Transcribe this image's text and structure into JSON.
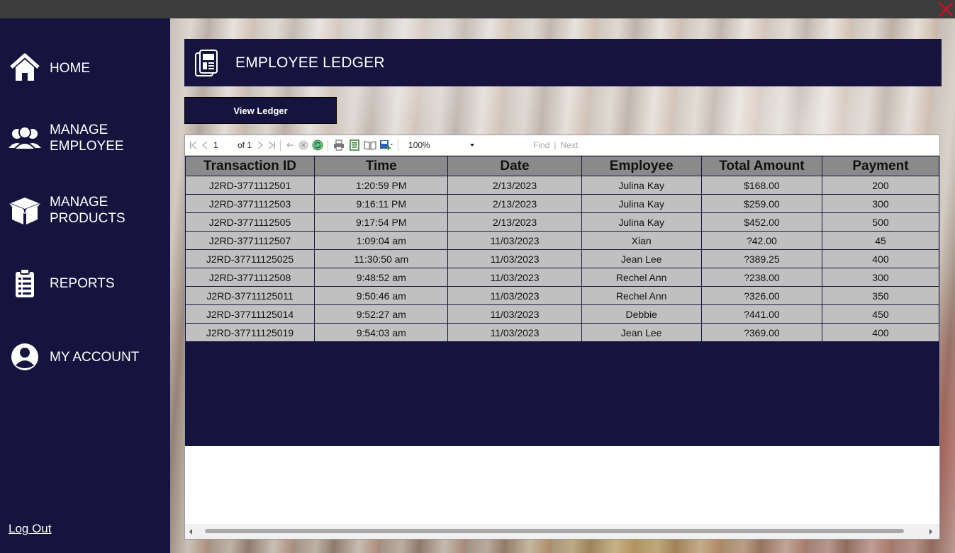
{
  "window": {
    "close_icon": "close-x-icon",
    "close_color": "#d01020"
  },
  "sidebar": {
    "background": "#16143f",
    "items": [
      {
        "label": "HOME",
        "icon": "home-icon"
      },
      {
        "label": "MANAGE\nEMPLOYEE",
        "icon": "users-icon"
      },
      {
        "label": "MANAGE\nPRODUCTS",
        "icon": "box-icon"
      },
      {
        "label": "REPORTS",
        "icon": "clipboard-icon"
      },
      {
        "label": "MY ACCOUNT",
        "icon": "user-circle-icon"
      }
    ],
    "logout_label": "Log Out"
  },
  "header": {
    "title": "EMPLOYEE LEDGER",
    "icon": "ledger-icon"
  },
  "actions": {
    "view_ledger_label": "View Ledger"
  },
  "report_toolbar": {
    "page_current": "1",
    "page_of": "of 1",
    "zoom": "100%",
    "find_label": "Find",
    "next_label": "Next"
  },
  "ledger": {
    "columns": [
      "Transaction ID",
      "Time",
      "Date",
      "Employee",
      "Total Amount",
      "Payment"
    ],
    "rows": [
      [
        "J2RD-3771112501",
        "1:20:59 PM",
        "2/13/2023",
        "Julina Kay",
        "$168.00",
        "200"
      ],
      [
        "J2RD-3771112503",
        "9:16:11 PM",
        "2/13/2023",
        "Julina Kay",
        "$259.00",
        "300"
      ],
      [
        "J2RD-3771112505",
        "9:17:54 PM",
        "2/13/2023",
        "Julina Kay",
        "$452.00",
        "500"
      ],
      [
        "J2RD-3771112507",
        "1:09:04 am",
        "11/03/2023",
        "Xian",
        "?42.00",
        "45"
      ],
      [
        "J2RD-37711125025",
        "11:30:50 am",
        "11/03/2023",
        "Jean Lee",
        "?389.25",
        "400"
      ],
      [
        "J2RD-3771112508",
        "9:48:52 am",
        "11/03/2023",
        "Rechel Ann",
        "?238.00",
        "300"
      ],
      [
        "J2RD-37711125011",
        "9:50:46 am",
        "11/03/2023",
        "Rechel Ann",
        "?326.00",
        "350"
      ],
      [
        "J2RD-37711125014",
        "9:52:27 am",
        "11/03/2023",
        "Debbie",
        "?441.00",
        "450"
      ],
      [
        "J2RD-37711125019",
        "9:54:03 am",
        "11/03/2023",
        "Jean Lee",
        "?369.00",
        "400"
      ]
    ]
  }
}
